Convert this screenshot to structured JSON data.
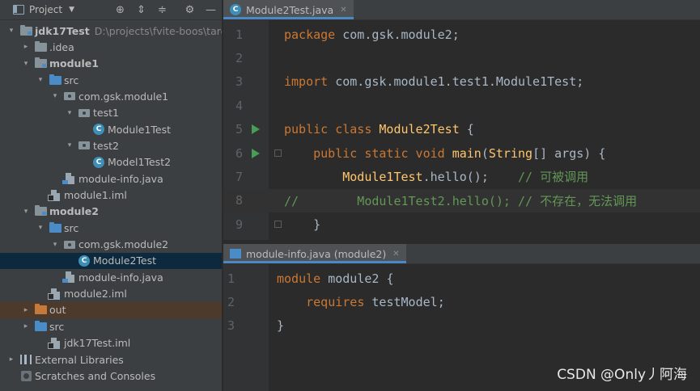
{
  "project_panel": {
    "title": "Project",
    "toolbar_icons": [
      "locate-icon",
      "expand-all-icon",
      "collapse-all-icon",
      "gear-icon",
      "minimize-icon"
    ],
    "tree": [
      {
        "label": "jdk17Test",
        "path": "D:\\projects\\fvite-boos\\targ",
        "depth": 0,
        "arrow": "down",
        "icon": "module-folder",
        "bold": true
      },
      {
        "label": ".idea",
        "depth": 1,
        "arrow": "right",
        "icon": "folder"
      },
      {
        "label": "module1",
        "depth": 1,
        "arrow": "down",
        "icon": "module-folder",
        "bold": true
      },
      {
        "label": "src",
        "depth": 2,
        "arrow": "down",
        "icon": "source-folder"
      },
      {
        "label": "com.gsk.module1",
        "depth": 3,
        "arrow": "down",
        "icon": "package"
      },
      {
        "label": "test1",
        "depth": 4,
        "arrow": "down",
        "icon": "package"
      },
      {
        "label": "Module1Test",
        "depth": 5,
        "arrow": "none",
        "icon": "class"
      },
      {
        "label": "test2",
        "depth": 4,
        "arrow": "down",
        "icon": "package"
      },
      {
        "label": "Model1Test2",
        "depth": 5,
        "arrow": "none",
        "icon": "class"
      },
      {
        "label": "module-info.java",
        "depth": 3,
        "arrow": "none",
        "icon": "java-file"
      },
      {
        "label": "module1.iml",
        "depth": 2,
        "arrow": "none",
        "icon": "iml-file"
      },
      {
        "label": "module2",
        "depth": 1,
        "arrow": "down",
        "icon": "module-folder",
        "bold": true
      },
      {
        "label": "src",
        "depth": 2,
        "arrow": "down",
        "icon": "source-folder"
      },
      {
        "label": "com.gsk.module2",
        "depth": 3,
        "arrow": "down",
        "icon": "package"
      },
      {
        "label": "Module2Test",
        "depth": 4,
        "arrow": "none",
        "icon": "class",
        "selected": true
      },
      {
        "label": "module-info.java",
        "depth": 3,
        "arrow": "none",
        "icon": "java-file"
      },
      {
        "label": "module2.iml",
        "depth": 2,
        "arrow": "none",
        "icon": "iml-file"
      },
      {
        "label": "out",
        "depth": 1,
        "arrow": "right",
        "icon": "excluded-folder",
        "excluded": true
      },
      {
        "label": "src",
        "depth": 1,
        "arrow": "right",
        "icon": "source-folder"
      },
      {
        "label": "jdk17Test.iml",
        "depth": 2,
        "arrow": "none",
        "icon": "iml-file"
      },
      {
        "label": "External Libraries",
        "depth": 0,
        "arrow": "right",
        "icon": "libraries"
      },
      {
        "label": "Scratches and Consoles",
        "depth": 0,
        "arrow": "none",
        "icon": "scratches"
      }
    ]
  },
  "top_editor": {
    "tab": {
      "label": "Module2Test.java",
      "icon": "class-icon"
    },
    "lines": [
      {
        "n": "1",
        "tokens": [
          [
            "kw",
            "package "
          ],
          [
            "pkgname",
            "com.gsk.module2"
          ],
          [
            "plain",
            ";"
          ]
        ]
      },
      {
        "n": "2",
        "tokens": []
      },
      {
        "n": "3",
        "tokens": [
          [
            "kw",
            "import "
          ],
          [
            "pkgname",
            "com.gsk.module1.test1.Module1Test"
          ],
          [
            "plain",
            ";"
          ]
        ]
      },
      {
        "n": "4",
        "tokens": []
      },
      {
        "n": "5",
        "run": true,
        "tokens": [
          [
            "kw",
            "public class "
          ],
          [
            "ty",
            "Module2Test"
          ],
          [
            "plain",
            " {"
          ]
        ]
      },
      {
        "n": "6",
        "run": true,
        "fold": true,
        "tokens": [
          [
            "plain",
            "    "
          ],
          [
            "kw",
            "public static void "
          ],
          [
            "ty",
            "main"
          ],
          [
            "plain",
            "("
          ],
          [
            "ty",
            "String"
          ],
          [
            "plain",
            "[] args) {"
          ]
        ]
      },
      {
        "n": "7",
        "tokens": [
          [
            "plain",
            "        "
          ],
          [
            "ty",
            "Module1Test"
          ],
          [
            "plain",
            ".hello();    "
          ],
          [
            "cm",
            "// 可被调用"
          ]
        ]
      },
      {
        "n": "8",
        "highlight": true,
        "tokens": [
          [
            "cm",
            "//        Module1Test2.hello(); // 不存在，无法调用"
          ]
        ]
      },
      {
        "n": "9",
        "fold": true,
        "tokens": [
          [
            "plain",
            "    }"
          ]
        ]
      }
    ]
  },
  "bottom_editor": {
    "tab": {
      "label": "module-info.java (module2)",
      "icon": "module-info-icon"
    },
    "lines": [
      {
        "n": "1",
        "tokens": [
          [
            "kw",
            "module "
          ],
          [
            "pkgname",
            "module2"
          ],
          [
            "plain",
            " {"
          ]
        ]
      },
      {
        "n": "2",
        "tokens": [
          [
            "plain",
            "    "
          ],
          [
            "kw",
            "requires "
          ],
          [
            "pkgname",
            "testModel"
          ],
          [
            "plain",
            ";"
          ]
        ]
      },
      {
        "n": "3",
        "tokens": [
          [
            "plain",
            "}"
          ]
        ]
      }
    ]
  },
  "watermark": "CSDN @Only丿阿海"
}
